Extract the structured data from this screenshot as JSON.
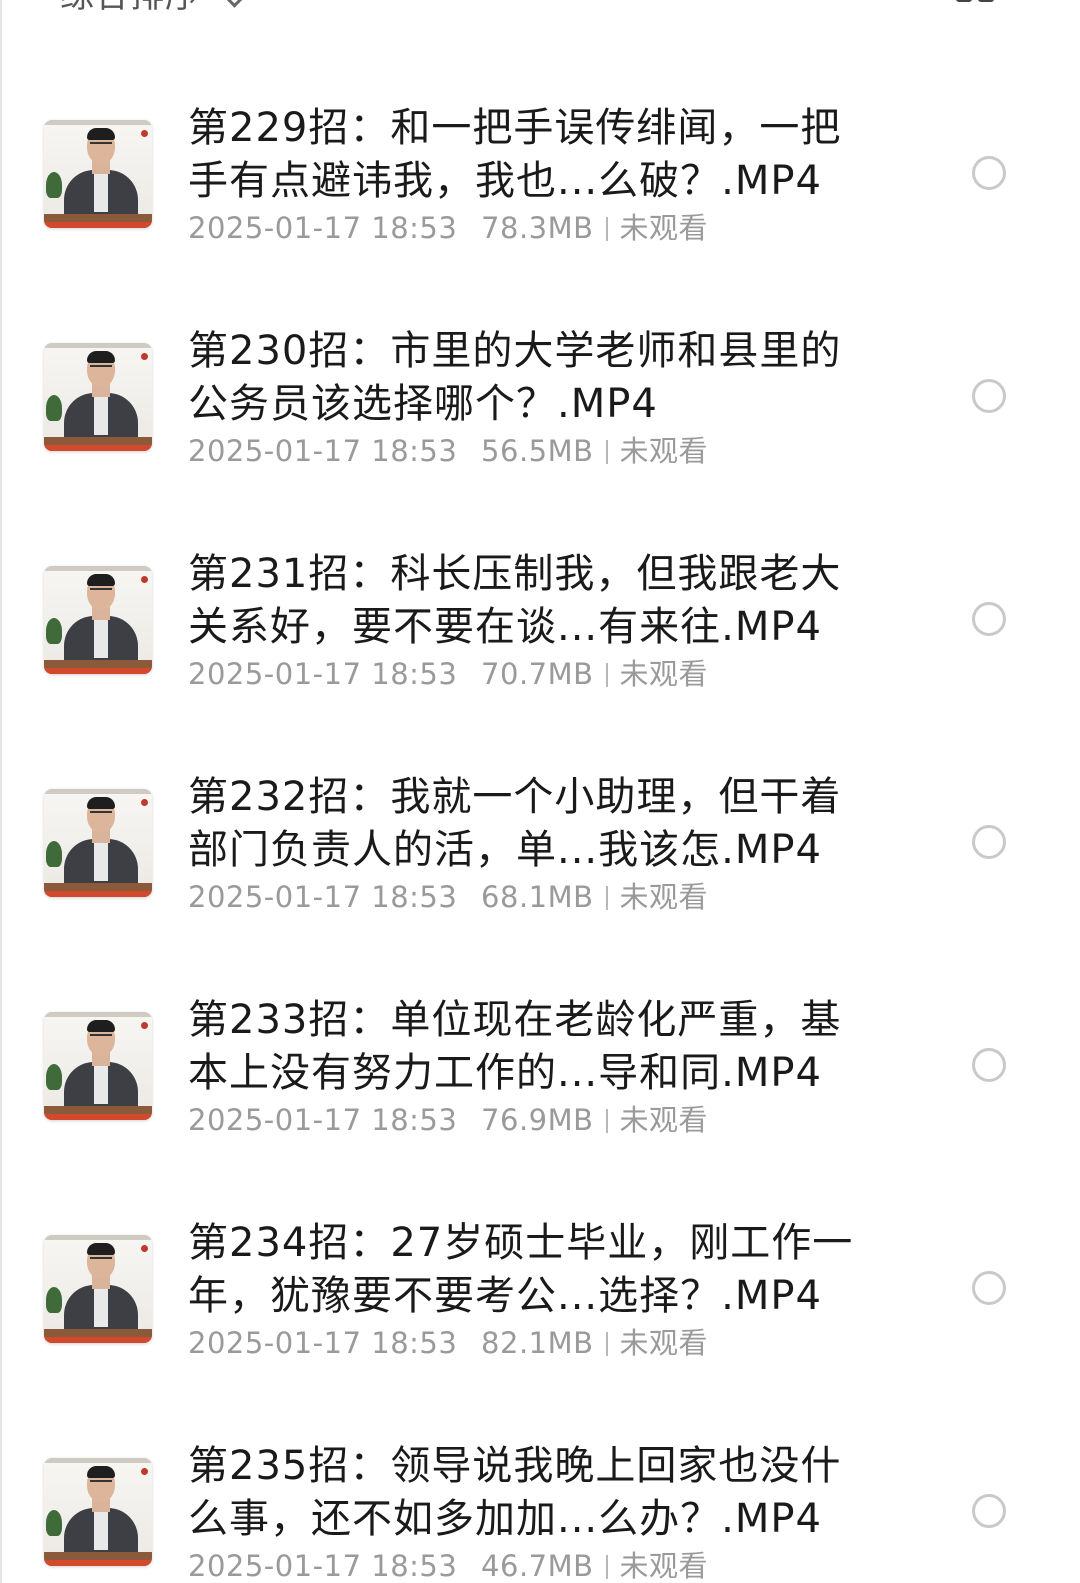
{
  "header": {
    "sort_label": "综合排序",
    "sort_icon": "chevron-down-icon",
    "view_toggle_icon": "grid-view-icon"
  },
  "files": [
    {
      "title": "第229招：和一把手误传绯闻，一把\n手有点避讳我，我也...么破？.MP4",
      "date": "2025-01-17 18:53",
      "size": "78.3MB",
      "status": "未观看"
    },
    {
      "title": "第230招：市里的大学老师和县里的\n公务员该选择哪个？.MP4",
      "date": "2025-01-17 18:53",
      "size": "56.5MB",
      "status": "未观看"
    },
    {
      "title": "第231招：科长压制我，但我跟老大\n关系好，要不要在谈...有来往.MP4",
      "date": "2025-01-17 18:53",
      "size": "70.7MB",
      "status": "未观看"
    },
    {
      "title": "第232招：我就一个小助理，但干着\n部门负责人的活，单...我该怎.MP4",
      "date": "2025-01-17 18:53",
      "size": "68.1MB",
      "status": "未观看"
    },
    {
      "title": "第233招：单位现在老龄化严重，基\n本上没有努力工作的...导和同.MP4",
      "date": "2025-01-17 18:53",
      "size": "76.9MB",
      "status": "未观看"
    },
    {
      "title": "第234招：27岁硕士毕业，刚工作一\n年，犹豫要不要考公...选择？.MP4",
      "date": "2025-01-17 18:53",
      "size": "82.1MB",
      "status": "未观看"
    },
    {
      "title": "第235招：领导说我晚上回家也没什\n么事，还不如多加加...么办？.MP4",
      "date": "2025-01-17 18:53",
      "size": "46.7MB",
      "status": "未观看"
    }
  ],
  "colors": {
    "title_text": "#1a1a1a",
    "meta_text": "#9a9a9a",
    "radio_border": "#c9c9c9",
    "background": "#ffffff"
  }
}
